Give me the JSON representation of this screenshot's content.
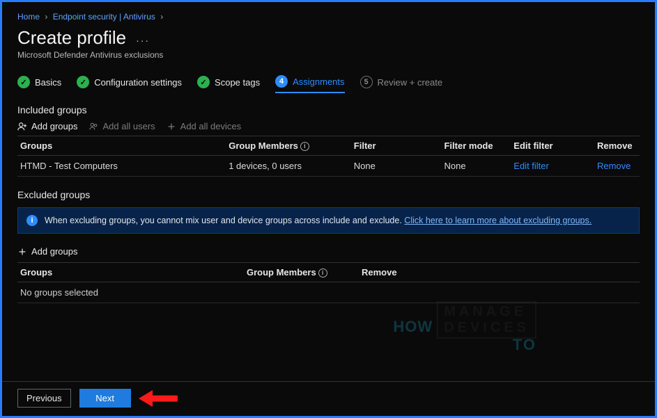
{
  "breadcrumb": {
    "home": "Home",
    "section": "Endpoint security | Antivirus"
  },
  "page": {
    "title": "Create profile",
    "subtitle": "Microsoft Defender Antivirus exclusions",
    "more": "···"
  },
  "wizard": {
    "steps": [
      {
        "num": "✓",
        "label": "Basics",
        "state": "done"
      },
      {
        "num": "✓",
        "label": "Configuration settings",
        "state": "done"
      },
      {
        "num": "✓",
        "label": "Scope tags",
        "state": "done"
      },
      {
        "num": "4",
        "label": "Assignments",
        "state": "active"
      },
      {
        "num": "5",
        "label": "Review + create",
        "state": "pending"
      }
    ]
  },
  "included": {
    "heading": "Included groups",
    "toolbar": {
      "add_groups": "Add groups",
      "add_all_users": "Add all users",
      "add_all_devices": "Add all devices"
    },
    "columns": {
      "groups": "Groups",
      "members": "Group Members",
      "filter": "Filter",
      "mode": "Filter mode",
      "edit": "Edit filter",
      "remove": "Remove"
    },
    "rows": [
      {
        "group": "HTMD - Test Computers",
        "members": "1 devices, 0 users",
        "filter": "None",
        "mode": "None",
        "edit": "Edit filter",
        "remove": "Remove"
      }
    ]
  },
  "excluded": {
    "heading": "Excluded groups",
    "notice_text": "When excluding groups, you cannot mix user and device groups across include and exclude.",
    "notice_link": "Click here to learn more about excluding groups.",
    "add_groups": "Add groups",
    "columns": {
      "groups": "Groups",
      "members": "Group Members",
      "remove": "Remove"
    },
    "empty": "No groups selected"
  },
  "footer": {
    "previous": "Previous",
    "next": "Next"
  },
  "watermark": {
    "how": "HOW",
    "to": "TO",
    "line1": "MANAGE",
    "line2": "DEVICES"
  }
}
